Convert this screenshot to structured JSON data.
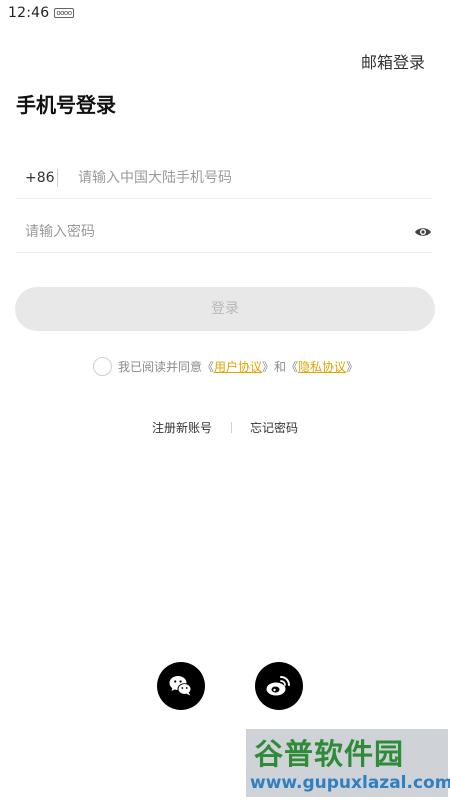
{
  "status_bar": {
    "time": "12:46",
    "indicator": "oooo"
  },
  "header": {
    "email_login_label": "邮箱登录",
    "title": "手机号登录"
  },
  "form": {
    "country_code": "+86",
    "phone_placeholder": "请输入中国大陆手机号码",
    "password_placeholder": "请输入密码",
    "login_label": "登录"
  },
  "agreement": {
    "prefix": "我已阅读并同意《",
    "user_agreement": "用户协议",
    "middle": "》和《",
    "privacy_policy": "隐私协议",
    "suffix": "》"
  },
  "links": {
    "register": "注册新账号",
    "forgot_password": "忘记密码"
  },
  "social": {
    "icons": [
      "wechat-icon",
      "weibo-icon"
    ]
  },
  "watermark": {
    "title": "谷普软件园",
    "url": "www.gupuxlazal.com"
  },
  "colors": {
    "link_accent": "#e0a400",
    "button_disabled": "#e8e8e8",
    "social_bg": "#000000"
  }
}
